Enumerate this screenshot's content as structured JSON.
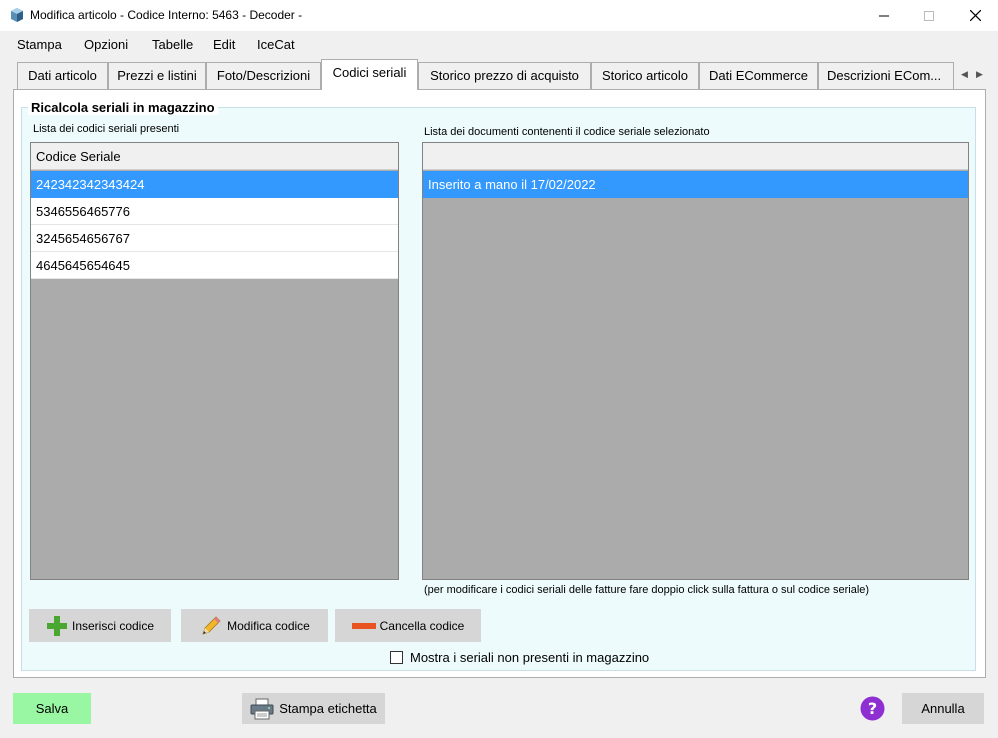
{
  "window": {
    "title": "Modifica articolo - Codice Interno: 5463 - Decoder -",
    "controls": {
      "minimize_icon": "minimize-icon",
      "maximize_icon": "maximize-icon",
      "close_icon": "close-icon"
    }
  },
  "menu": [
    "Stampa",
    "Opzioni",
    "Tabelle",
    "Edit",
    "IceCat"
  ],
  "tabs": [
    {
      "label": "Dati articolo",
      "active": false
    },
    {
      "label": "Prezzi e listini",
      "active": false
    },
    {
      "label": "Foto/Descrizioni",
      "active": false
    },
    {
      "label": "Codici seriali",
      "active": true
    },
    {
      "label": "Storico prezzo di acquisto",
      "active": false
    },
    {
      "label": "Storico articolo",
      "active": false
    },
    {
      "label": "Dati ECommerce",
      "active": false
    },
    {
      "label": "Descrizioni  ECom...",
      "active": false
    }
  ],
  "group": {
    "title": "Ricalcola seriali in magazzino",
    "serials_label": "Lista dei codici seriali presenti",
    "serials_header": "Codice Seriale",
    "serials": [
      "242342342343424",
      "5346556465776",
      "3245654656767",
      "4645645654645"
    ],
    "selected_serial_index": 0,
    "documents_label": "Lista dei documenti contenenti il codice seriale selezionato",
    "documents_header": "",
    "documents": [
      "Inserito a mano il 17/02/2022"
    ],
    "hint": "(per modificare i codici seriali delle fatture fare doppio click sulla fattura o sul codice seriale)",
    "buttons": {
      "insert": "Inserisci codice",
      "edit": "Modifica codice",
      "delete": "Cancella codice"
    },
    "checkbox_label": "Mostra i seriali non presenti in magazzino",
    "checkbox_checked": false
  },
  "footer": {
    "save": "Salva",
    "print_label": "Stampa etichetta",
    "help_icon": "help-icon",
    "cancel": "Annulla"
  },
  "colors": {
    "selection": "#3399ff",
    "save_button": "#99f7a3",
    "help_icon": "#8e2fd1",
    "list_background": "#ababab",
    "group_background": "#eefbfd"
  }
}
